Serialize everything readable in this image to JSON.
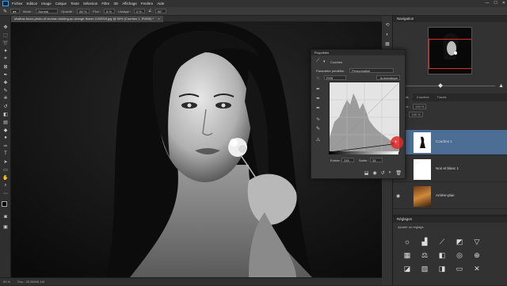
{
  "app": {
    "logo": "Ps"
  },
  "menu": [
    "Fichier",
    "Edition",
    "Image",
    "Calque",
    "Texte",
    "Sélection",
    "Filtre",
    "3D",
    "Affichage",
    "Fenêtre",
    "Aide"
  ],
  "window_controls": [
    "—",
    "☐",
    "✕"
  ],
  "options": {
    "mode_label": "Mode :",
    "mode_value": "Normal",
    "opacity_label": "Opacité :",
    "opacity_value": "85 %",
    "flow_label": "Flux :",
    "flow_value": "8 %",
    "smoothing_label": "Lissage :",
    "smoothing_value": "0 %",
    "angle_value": "90°"
  },
  "document": {
    "tab_title": "shallow-focus-photo-of-woman-holding-an-orange-flower-1163918.jpg @ 50% (Courbes 1, RVB/8) *",
    "tab_close": "×"
  },
  "status": {
    "zoom": "50 %",
    "doc_info": "Doc : 20,5M/40,1M"
  },
  "navigator": {
    "title": "Navigation"
  },
  "properties": {
    "title": "Propriétés",
    "subtitle": "Courbes",
    "preset_label": "Paramètre prédéfini :",
    "preset_value": "Personnalisé",
    "channel_value": "RVB",
    "auto_label": "Automatique",
    "input_label": "Entrée :",
    "input_value": "255",
    "output_label": "Sortie :",
    "output_value": "35"
  },
  "layers": {
    "tabs": [
      "Calques",
      "Couches",
      "Tracés"
    ],
    "opacity_label": "Opacité :",
    "opacity_value": "100 %",
    "fill_label": "Fond :",
    "fill_value": "100 %",
    "items": [
      {
        "name": "Courbes 1"
      },
      {
        "name": "Noir et blanc 1"
      },
      {
        "name": "Arrière-plan"
      }
    ]
  },
  "adjustments": {
    "title": "Réglages",
    "subtitle": "Ajouter un réglage"
  },
  "colors": {
    "accent": "#4c6d94",
    "highlight": "#e02a2a"
  }
}
